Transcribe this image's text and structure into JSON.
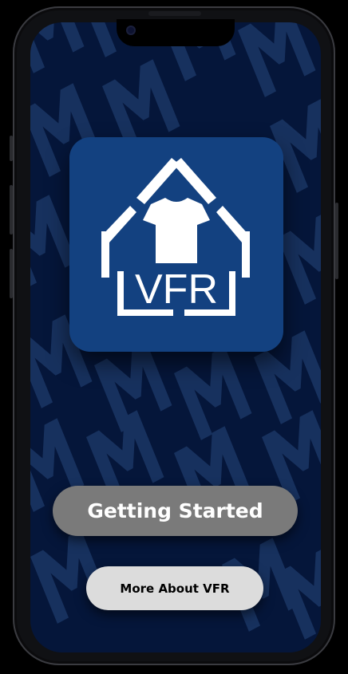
{
  "app": {
    "logo_text": "VFR"
  },
  "actions": {
    "getting_started_label": "Getting Started",
    "more_about_label": "More About VFR"
  },
  "colors": {
    "background": "#05163a",
    "pattern": "#1a3563",
    "logo_tile": "#134180",
    "primary_button": "#7a7a7a",
    "secondary_button": "#dcdcdc"
  },
  "icons": {
    "logo": "house-shirt-logo-icon",
    "background_pattern": "letter-m-pattern"
  }
}
